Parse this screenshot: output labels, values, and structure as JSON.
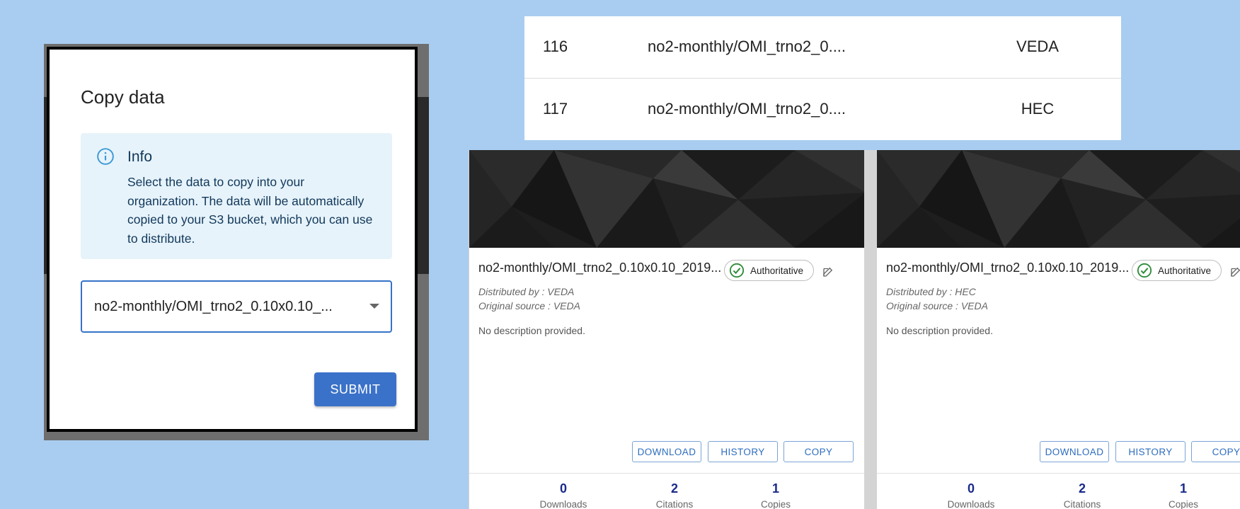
{
  "dialog": {
    "title": "Copy data",
    "info": {
      "title": "Info",
      "text": "Select the data to copy into your organization. The data will be automatically copied to your S3 bucket, which you can use to distribute."
    },
    "select": {
      "value": "no2-monthly/OMI_trno2_0.10x0.10_..."
    },
    "submit_label": "SUBMIT"
  },
  "table": {
    "rows": [
      {
        "id": "116",
        "name": "no2-monthly/OMI_trno2_0....",
        "distributor": "VEDA"
      },
      {
        "id": "117",
        "name": "no2-monthly/OMI_trno2_0....",
        "distributor": "HEC"
      }
    ]
  },
  "cards": [
    {
      "title": "no2-monthly/OMI_trno2_0.10x0.10_2019...",
      "badge": "Authoritative",
      "distributed_by": "Distributed by : VEDA",
      "original_source": "Original source : VEDA",
      "description": "No description provided.",
      "buttons": {
        "download": "DOWNLOAD",
        "history": "HISTORY",
        "copy": "COPY"
      },
      "stats": [
        {
          "value": "0",
          "label": "Downloads"
        },
        {
          "value": "2",
          "label": "Citations"
        },
        {
          "value": "1",
          "label": "Copies"
        }
      ]
    },
    {
      "title": "no2-monthly/OMI_trno2_0.10x0.10_2019...",
      "badge": "Authoritative",
      "distributed_by": "Distributed by : HEC",
      "original_source": "Original source : VEDA",
      "description": "No description provided.",
      "buttons": {
        "download": "DOWNLOAD",
        "history": "HISTORY",
        "copy": "COPY"
      },
      "stats": [
        {
          "value": "0",
          "label": "Downloads"
        },
        {
          "value": "2",
          "label": "Citations"
        },
        {
          "value": "1",
          "label": "Copies"
        }
      ]
    }
  ],
  "colors": {
    "page_background": "#a9cdf0",
    "primary": "#3b72c9",
    "info_background": "#e7f3fb",
    "badge_check": "#2e8b3a",
    "stat_number": "#1a2a8a"
  },
  "icons": [
    "info-icon",
    "check-circle-icon",
    "edit-icon",
    "chevron-down-icon"
  ]
}
